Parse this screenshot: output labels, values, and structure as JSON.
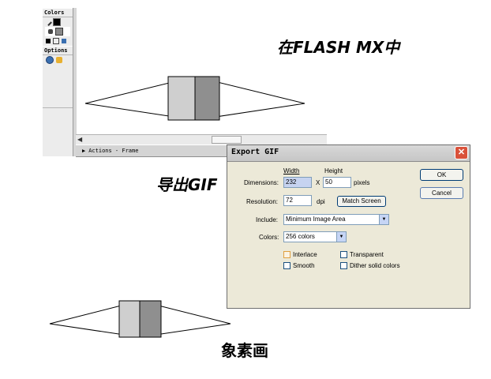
{
  "captions": {
    "top": "在FLASH MX中",
    "middle": "导出GIF",
    "bottom": "象素画"
  },
  "tools_panel": {
    "colors_header": "Colors",
    "options_header": "Options"
  },
  "actions_bar": {
    "label": "Actions - Frame"
  },
  "dialog": {
    "title": "Export GIF",
    "width_header": "Width",
    "height_header": "Height",
    "dimensions_label": "Dimensions:",
    "width_value": "232",
    "x_label": "X",
    "height_value": "50",
    "pixels_label": "pixels",
    "resolution_label": "Resolution:",
    "resolution_value": "72",
    "dpi_label": "dpi",
    "match_screen_label": "Match Screen",
    "include_label": "Include:",
    "include_value": "Minimum Image Area",
    "colors_label": "Colors:",
    "colors_value": "256 colors",
    "interlace_label": "Interlace",
    "transparent_label": "Transparent",
    "smooth_label": "Smooth",
    "dither_label": "Dither solid colors",
    "ok_label": "OK",
    "cancel_label": "Cancel"
  },
  "colors": {
    "dialog_bg": "#ece9d8",
    "button_border": "#003c74",
    "close_button": "#d9513a",
    "face_light": "#cfcfcf",
    "face_dark": "#8f8f8f"
  }
}
